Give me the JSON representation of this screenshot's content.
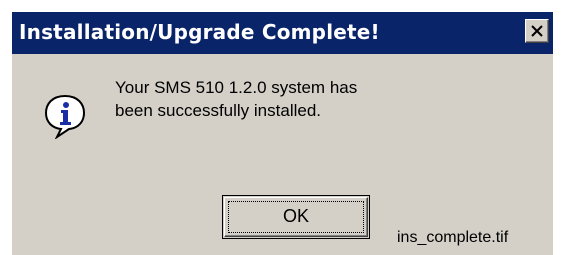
{
  "dialog": {
    "title": "Installation/Upgrade Complete!",
    "close_icon": "close-icon",
    "icon": "information-icon",
    "message_line1": "Your SMS 510 1.2.0 system has",
    "message_line2": "been successfully installed.",
    "ok_label": "OK"
  },
  "caption": "ins_complete.tif",
  "colors": {
    "titlebar": "#0a246a",
    "dialog_face": "#d4d0c8",
    "icon_blue": "#1a2fa6"
  }
}
